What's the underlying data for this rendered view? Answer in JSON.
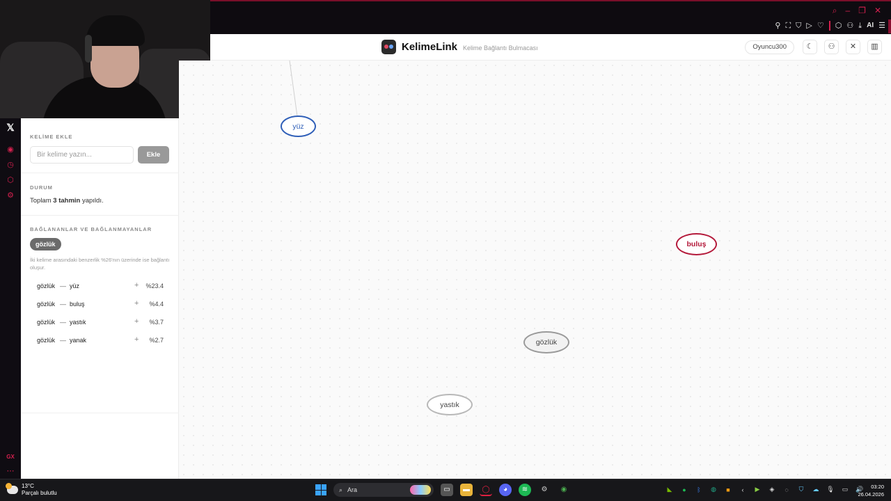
{
  "browser": {
    "window_controls": [
      "⌕",
      "–",
      "❐",
      "✕"
    ],
    "extension_ai_label": "AI"
  },
  "header": {
    "app_name": "KelimeLink",
    "app_subtitle": "Kelime Bağlantı Bulmacası",
    "username": "Oyuncu300"
  },
  "panel": {
    "add_section_title": "KELİME EKLE",
    "input_placeholder": "Bir kelime yazın...",
    "add_button": "Ekle",
    "status_title": "DURUM",
    "status_prefix": "Toplam ",
    "status_count": "3 tahmin",
    "status_suffix": " yapıldı.",
    "connections_title": "BAĞLANANLAR VE BAĞLANMAYANLAR",
    "selected_word": "gözlük",
    "hint": "İki kelime arasındaki benzerlik %26'nın üzerinde ise bağlantı oluşur.",
    "pairs": [
      {
        "a": "gözlük",
        "b": "yüz",
        "pct": "%23.4"
      },
      {
        "a": "gözlük",
        "b": "buluş",
        "pct": "%4.4"
      },
      {
        "a": "gözlük",
        "b": "yastık",
        "pct": "%3.7"
      },
      {
        "a": "gözlük",
        "b": "yanak",
        "pct": "%2.7"
      }
    ]
  },
  "canvas": {
    "nodes": [
      {
        "label": "yüz",
        "style": "blue"
      },
      {
        "label": "buluş",
        "style": "red"
      },
      {
        "label": "gözlük",
        "style": "gray-active"
      },
      {
        "label": "yastık",
        "style": "gray"
      }
    ]
  },
  "taskbar": {
    "temperature": "13°C",
    "weather": "Parçalı bulutlu",
    "search_label": "Ara",
    "time": "03:20",
    "date": "26.04.2026"
  },
  "colors": {
    "accent_red": "#d4204e",
    "node_blue": "#2f5fb8",
    "node_red": "#b41a3b"
  }
}
